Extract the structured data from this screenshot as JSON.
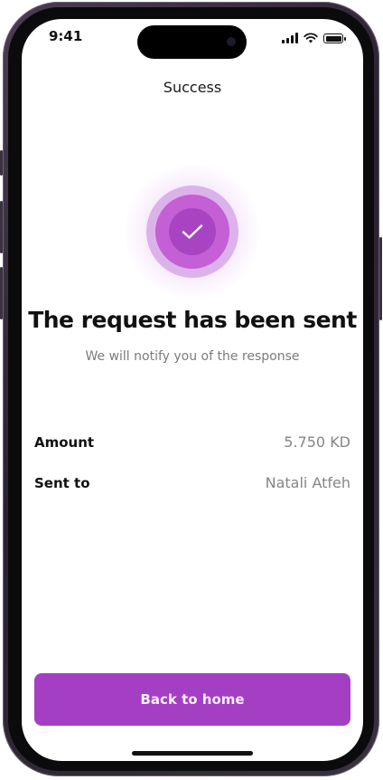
{
  "status_bar": {
    "time": "9:41"
  },
  "nav": {
    "title": "Success"
  },
  "success": {
    "headline": "The request has been sent",
    "subline": "We will notify you of the response"
  },
  "details": [
    {
      "label": "Amount",
      "value": "5.750 KD"
    },
    {
      "label": "Sent to",
      "value": "Natali Atfeh"
    }
  ],
  "actions": {
    "back_home_label": "Back to home"
  },
  "colors": {
    "accent": "#a43fc4",
    "ring_light": "#dcb2ea",
    "ring_mid": "#c45fd6",
    "ring_inner": "#a844c2"
  },
  "icons": {
    "success": "checkmark-icon",
    "signal": "cellular-signal-icon",
    "wifi": "wifi-icon",
    "battery": "battery-icon"
  }
}
